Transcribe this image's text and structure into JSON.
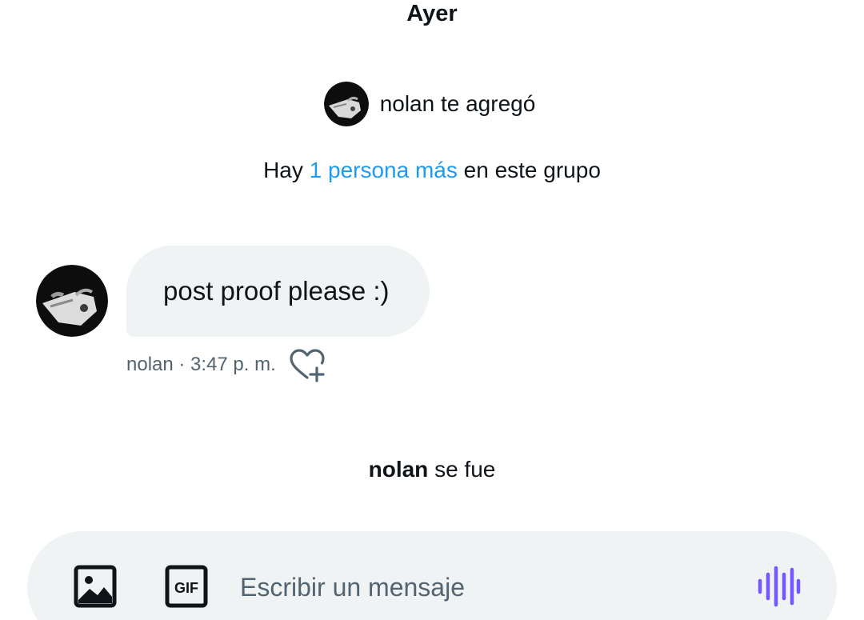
{
  "thread": {
    "date_separator": "Ayer",
    "added_event": {
      "text": "nolan te agregó"
    },
    "group_info": {
      "prefix": "Hay",
      "link": "1 persona más",
      "suffix": "en este grupo"
    },
    "message": {
      "text": "post proof please :)",
      "meta": "nolan · 3:47 p. m."
    },
    "left_event": {
      "name": "nolan",
      "text": "se fue"
    }
  },
  "composer": {
    "placeholder": "Escribir un mensaje",
    "value": "",
    "media_icon": "image-icon",
    "gif_label": "GIF",
    "voice_icon": "voice-waveform-icon"
  },
  "colors": {
    "link": "#1d9bf0",
    "bubble": "#eff3f4",
    "meta_text": "#536471",
    "voice_accent": "#7856ff"
  }
}
